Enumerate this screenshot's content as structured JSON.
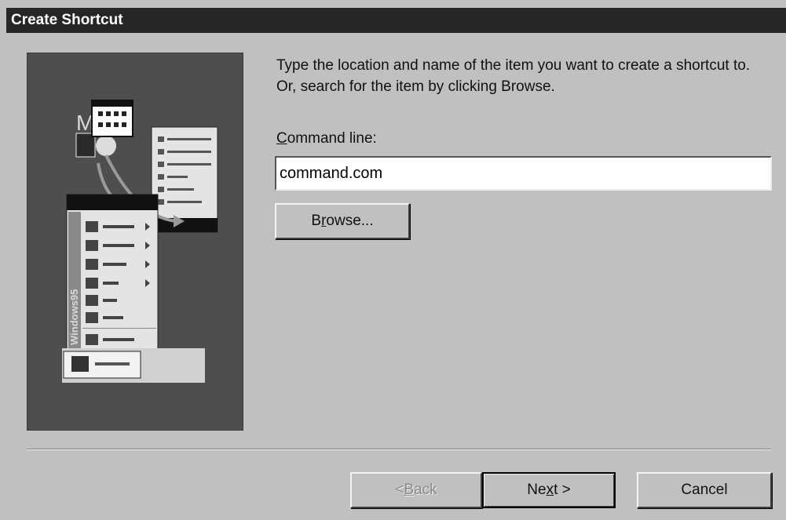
{
  "window": {
    "title": "Create Shortcut"
  },
  "art": {
    "icon_name": "start-menu-illustration",
    "sidebar_text": "Windows95"
  },
  "instructions": {
    "text": "Type the location and name of the item you want to create a shortcut to. Or, search for the item by clicking Browse."
  },
  "command_line": {
    "label_accel": "C",
    "label_rest": "ommand line:",
    "value": "command.com"
  },
  "buttons": {
    "browse_pre": "B",
    "browse_accel": "r",
    "browse_post": "owse...",
    "back_pre": "< ",
    "back_accel": "B",
    "back_post": "ack",
    "next_pre": "Ne",
    "next_accel": "x",
    "next_post": "t >",
    "cancel": "Cancel"
  },
  "colors": {
    "titlebar_bg": "#262626",
    "dialog_bg": "#c0c0c0",
    "art_bg": "#4e4e4e"
  }
}
